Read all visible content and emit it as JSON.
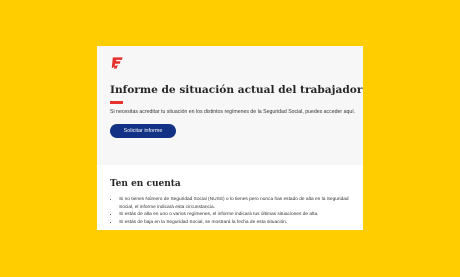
{
  "colors": {
    "background": "#ffcd00",
    "card": "#ffffff",
    "top_panel": "#f7f7f8",
    "accent": "#e4312b",
    "button": "#133285",
    "logo": "#e4312b"
  },
  "logo": {
    "icon": "social-security-logo-icon"
  },
  "header": {
    "title": "Informe de situación actual del trabajador",
    "description": "Si necesitas acreditar tu situación en los distintos regímenes de la Seguridad Social, puedes acceder aquí.",
    "button_label": "Solicitar informe"
  },
  "notes": {
    "title": "Ten en cuenta",
    "items": [
      "Si no tienes Número de Seguridad Social (NUSS) o lo tienes pero nunca has estado de alta en la Seguridad Social, el informe indicará esta circunstancia.",
      "Si estás de alta en uno o varios regímenes, el informe indicará tus últimas situaciones de alta.",
      "Si estás de baja en la Seguridad Social, se mostrará la fecha de esta situación."
    ]
  }
}
